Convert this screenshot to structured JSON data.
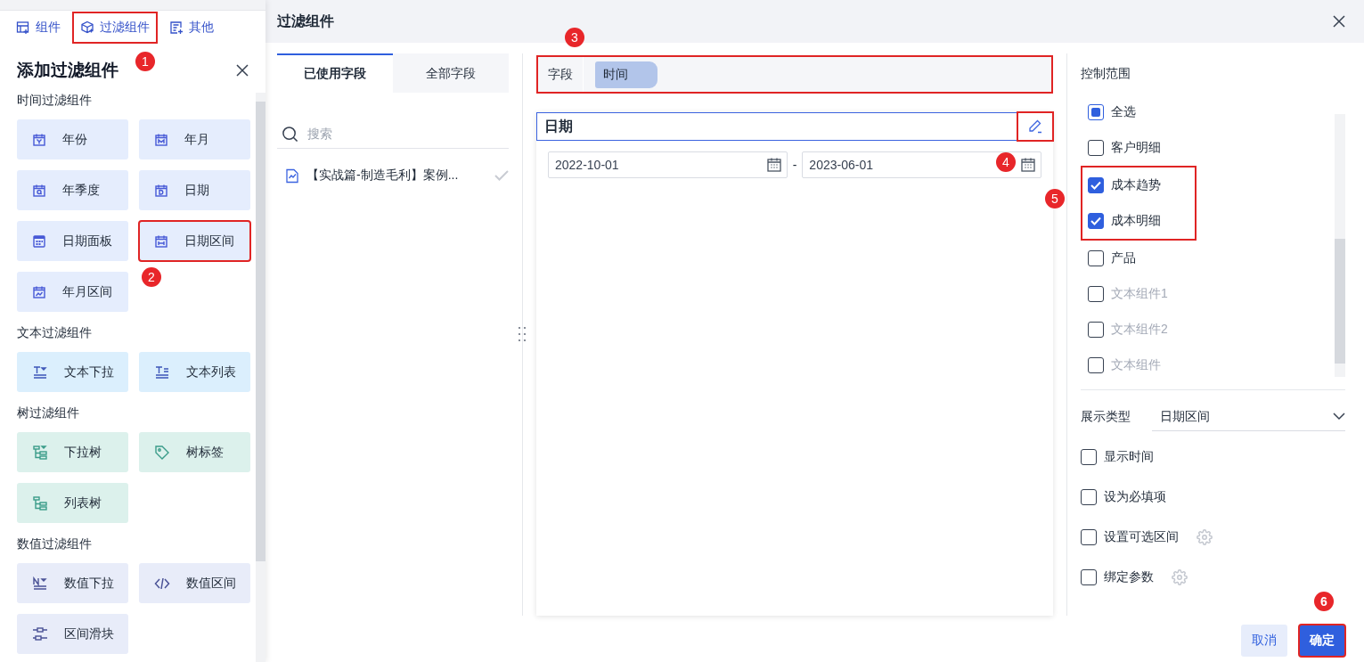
{
  "left_panel": {
    "tabs": [
      {
        "label": "组件",
        "highlighted": false
      },
      {
        "label": "过滤组件",
        "highlighted": true,
        "callout": "1"
      },
      {
        "label": "其他",
        "highlighted": false
      }
    ],
    "title": "添加过滤组件",
    "groups": [
      {
        "kind": "time",
        "label": "时间过滤组件",
        "tiles": [
          {
            "label": "年份",
            "highlighted": false
          },
          {
            "label": "年月",
            "highlighted": false
          },
          {
            "label": "年季度",
            "highlighted": false
          },
          {
            "label": "日期",
            "highlighted": false
          },
          {
            "label": "日期面板",
            "highlighted": false
          },
          {
            "label": "日期区间",
            "highlighted": true,
            "callout": "2"
          },
          {
            "label": "年月区间",
            "highlighted": false
          }
        ]
      },
      {
        "kind": "text",
        "label": "文本过滤组件",
        "tiles": [
          {
            "label": "文本下拉",
            "highlighted": false
          },
          {
            "label": "文本列表",
            "highlighted": false
          }
        ]
      },
      {
        "kind": "tree",
        "label": "树过滤组件",
        "tiles": [
          {
            "label": "下拉树",
            "highlighted": false
          },
          {
            "label": "树标签",
            "highlighted": false
          },
          {
            "label": "列表树",
            "highlighted": false
          }
        ]
      },
      {
        "kind": "number",
        "label": "数值过滤组件",
        "tiles": [
          {
            "label": "数值下拉",
            "highlighted": false
          },
          {
            "label": "数值区间",
            "highlighted": false
          },
          {
            "label": "区间滑块",
            "highlighted": false
          }
        ]
      }
    ]
  },
  "dialog": {
    "title": "过滤组件",
    "field_tabs": [
      {
        "label": "已使用字段",
        "selected": true
      },
      {
        "label": "全部字段",
        "selected": false
      }
    ],
    "search": {
      "placeholder": "搜索"
    },
    "fields": [
      {
        "label": "【实战篇-制造毛利】案例...",
        "checked": true
      }
    ],
    "field_bar": {
      "label": "字段",
      "chip": "时间",
      "callout": "3"
    },
    "card": {
      "title": "日期",
      "edit_callout": "4",
      "start": "2022-10-01",
      "separator": "-",
      "end": "2023-06-01"
    },
    "scope": {
      "label": "控制范围",
      "items": [
        {
          "kind": "item",
          "label": "全选",
          "checked": false,
          "indeterminate": true,
          "disabled": false
        },
        {
          "kind": "item",
          "label": "客户明细",
          "checked": false,
          "disabled": false
        },
        {
          "kind": "highlight",
          "callout": "5",
          "items": [
            {
              "kind": "item",
              "label": "成本趋势",
              "checked": true,
              "disabled": false
            },
            {
              "kind": "item",
              "label": "成本明细",
              "checked": true,
              "disabled": false
            }
          ]
        },
        {
          "kind": "item",
          "label": "产品",
          "checked": false,
          "disabled": false
        },
        {
          "kind": "item",
          "label": "文本组件1",
          "checked": false,
          "disabled": true
        },
        {
          "kind": "item",
          "label": "文本组件2",
          "checked": false,
          "disabled": true
        },
        {
          "kind": "item",
          "label": "文本组件",
          "checked": false,
          "disabled": true
        }
      ]
    },
    "display_type": {
      "label": "展示类型",
      "value": "日期区间"
    },
    "options": [
      {
        "label": "显示时间",
        "checked": false,
        "settings": false
      },
      {
        "label": "设为必填项",
        "checked": false,
        "settings": false
      },
      {
        "label": "设置可选区间",
        "checked": false,
        "settings": true
      },
      {
        "label": "绑定参数",
        "checked": false,
        "settings": true
      }
    ],
    "buttons": [
      {
        "label": "取消",
        "kind": "secondary",
        "highlighted": false
      },
      {
        "label": "确定",
        "kind": "primary",
        "highlighted": true,
        "callout": "6"
      }
    ]
  }
}
